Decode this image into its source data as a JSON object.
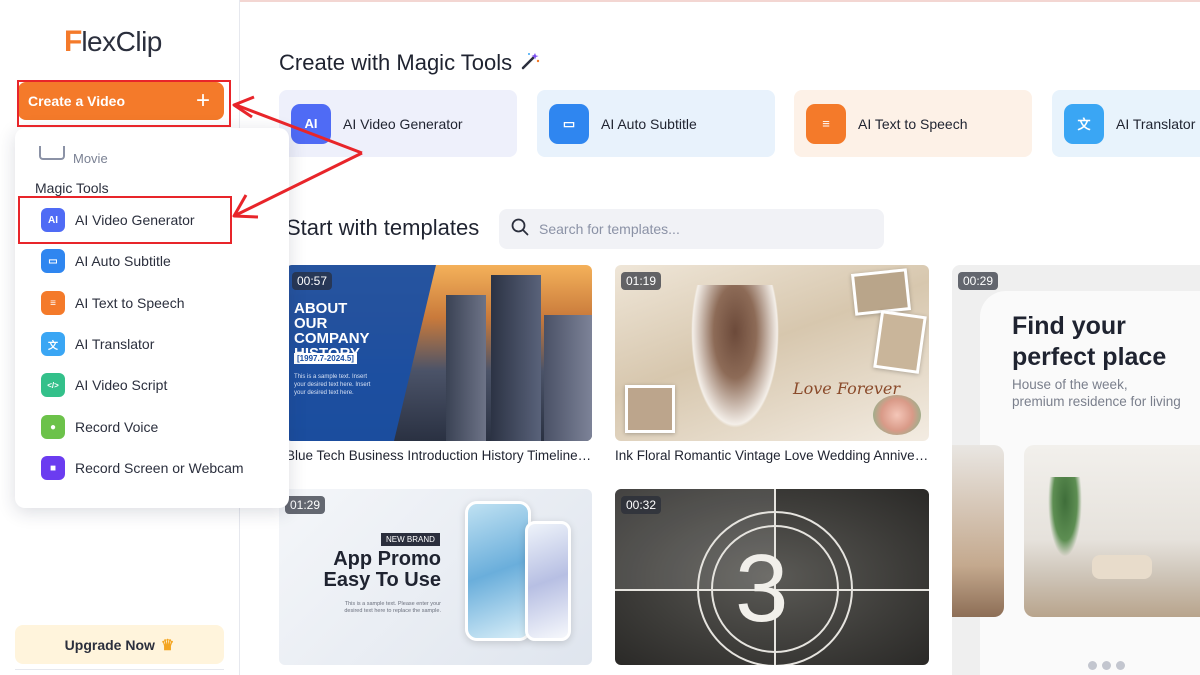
{
  "app": {
    "logo_f": "F",
    "logo_rest": "lexClip"
  },
  "sidebar": {
    "create_label": "Create a Video",
    "create_plus": "+",
    "dropdown": {
      "movie_label": "Movie",
      "section_label": "Magic Tools",
      "items": [
        {
          "label": "AI Video Generator",
          "icon": "ai-video-generator-icon",
          "icon_text": "AI",
          "color": "#4f6bf5"
        },
        {
          "label": "AI Auto Subtitle",
          "icon": "subtitle-icon",
          "icon_text": "▭",
          "color": "#2f86f0"
        },
        {
          "label": "AI Text to Speech",
          "icon": "speech-bubble-icon",
          "icon_text": "≡",
          "color": "#f47a2a"
        },
        {
          "label": "AI Translator",
          "icon": "translate-icon",
          "icon_text": "文",
          "color": "#3aa6f4"
        },
        {
          "label": "AI Video Script",
          "icon": "script-icon",
          "icon_text": "</>",
          "color": "#33c08a"
        },
        {
          "label": "Record Voice",
          "icon": "microphone-icon",
          "icon_text": "●",
          "color": "#6cc24a"
        },
        {
          "label": "Record Screen or Webcam",
          "icon": "camera-icon",
          "icon_text": "■",
          "color": "#6b3cf0"
        }
      ]
    },
    "upgrade_label": "Upgrade Now",
    "upgrade_icon": "♛"
  },
  "main": {
    "magic_heading": "Create with Magic Tools",
    "magic_icon": "magic-wand-icon",
    "tool_cards": [
      {
        "label": "AI Video Generator",
        "bg": "#eef0fb",
        "icon_bg": "#4f6bf5",
        "icon_text": "AI"
      },
      {
        "label": "AI Auto Subtitle",
        "bg": "#e8f2fc",
        "icon_bg": "#2f86f0",
        "icon_text": "▭"
      },
      {
        "label": "AI Text to Speech",
        "bg": "#fdf1e7",
        "icon_bg": "#f47a2a",
        "icon_text": "≡"
      },
      {
        "label": "AI Translator",
        "bg": "#e8f3fc",
        "icon_bg": "#3aa6f4",
        "icon_text": "文"
      }
    ],
    "templates_heading": "Start with templates",
    "search_placeholder": "Search for templates...",
    "templates": [
      {
        "duration": "00:57",
        "caption": "Blue Tech Business Introduction History Timeline C...",
        "title_text": "ABOUT OUR COMPANY HISTORY",
        "year_text": "[1997.7-2024.5]",
        "body_text": "This is a sample text. Insert your desired text here. Insert your desired text here."
      },
      {
        "duration": "01:19",
        "caption": "Ink Floral Romantic Vintage Love Wedding Anniver...",
        "title_text": "Love Forever"
      },
      {
        "duration": "00:29",
        "title_text": "Find your perfect place",
        "sub_text_1": "House of the week,",
        "sub_text_2": "premium residence for living"
      },
      {
        "duration": "01:29",
        "badge_text": "NEW BRAND",
        "title_text": "App Promo Easy To Use",
        "body_text": "This is a sample text. Please enter your desired text here to replace the sample."
      },
      {
        "duration": "00:32",
        "number_text": "3"
      }
    ]
  }
}
